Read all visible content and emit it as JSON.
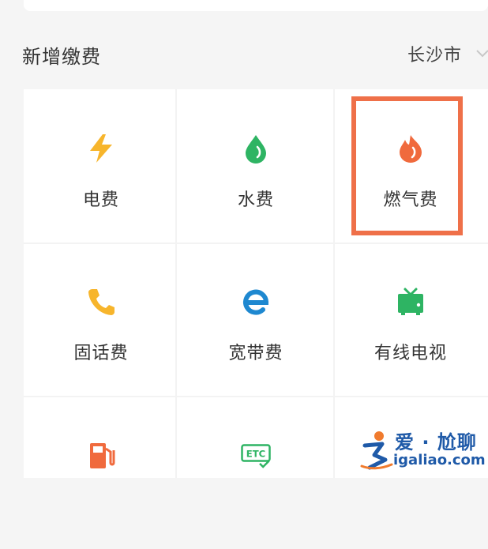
{
  "header": {
    "title": "新增缴费",
    "city": "长沙市"
  },
  "grid": {
    "items": [
      {
        "label": "电费",
        "icon": "lightning-icon",
        "color": "#f7b52c"
      },
      {
        "label": "水费",
        "icon": "water-drop-icon",
        "color": "#2eb463"
      },
      {
        "label": "燃气费",
        "icon": "flame-icon",
        "color": "#f06a3d"
      },
      {
        "label": "固话费",
        "icon": "phone-icon",
        "color": "#f7b52c"
      },
      {
        "label": "宽带费",
        "icon": "broadband-icon",
        "color": "#1e88d0"
      },
      {
        "label": "有线电视",
        "icon": "tv-icon",
        "color": "#2eb463"
      },
      {
        "label": "",
        "icon": "fuel-pump-icon",
        "color": "#f06a3d"
      },
      {
        "label": "",
        "icon": "etc-icon",
        "color": "#2eb463"
      }
    ]
  },
  "highlight": {
    "color": "#ef7049"
  },
  "watermark": {
    "text": "爱 · 尬聊",
    "url": "igaliao.com",
    "color": "#1f5aa8"
  }
}
